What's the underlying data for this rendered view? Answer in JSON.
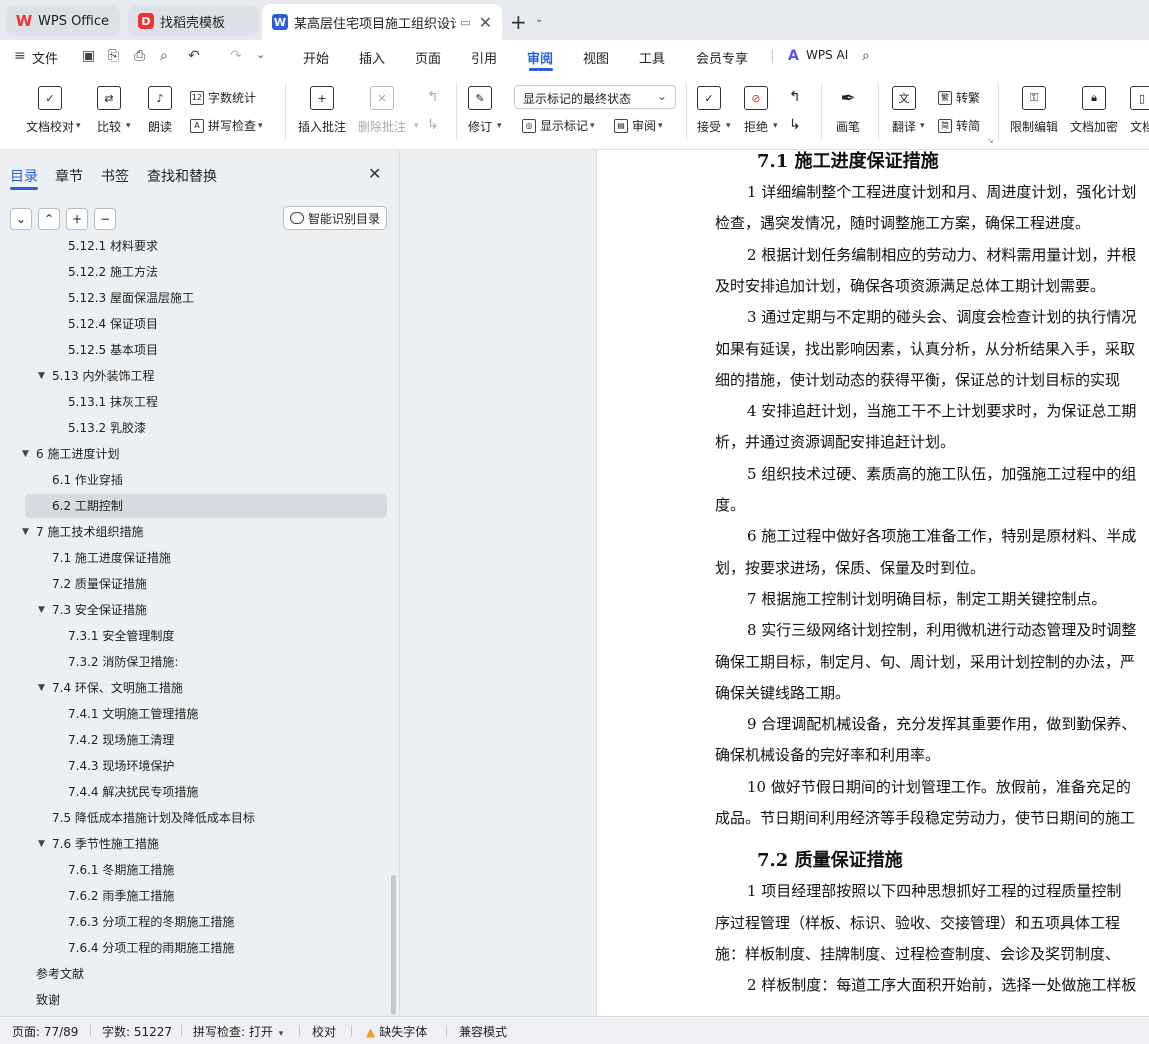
{
  "tabs": [
    {
      "label": "WPS Office",
      "icon": "wps-logo-icon"
    },
    {
      "label": "找稻壳模板",
      "icon": "docer-logo-icon"
    },
    {
      "label": "某高层住宅项目施工组织设计.docx",
      "icon": "word-doc-icon"
    }
  ],
  "menubar": {
    "file": "文件",
    "items": [
      "开始",
      "插入",
      "页面",
      "引用",
      "审阅",
      "视图",
      "工具",
      "会员专享"
    ],
    "active": "审阅",
    "wps_ai": "WPS AI"
  },
  "ribbon": {
    "doc_check": "文档校对",
    "compare": "比较",
    "read_aloud": "朗读",
    "word_count": "字数统计",
    "spell_check": "拼写检查",
    "insert_comment": "插入批注",
    "delete_comment": "删除批注",
    "revise": "修订",
    "markup_state": "显示标记的最终状态",
    "show_markup": "显示标记",
    "review": "审阅",
    "accept": "接受",
    "reject": "拒绝",
    "pen": "画笔",
    "translate": "翻译",
    "to_traditional": "转繁",
    "to_simplified": "转简",
    "restrict_edit": "限制编辑",
    "doc_encrypt": "文档加密",
    "doc_more": "文档"
  },
  "sidebar": {
    "tabs": [
      "目录",
      "章节",
      "书签",
      "查找和替换"
    ],
    "smart_toc": "智能识别目录",
    "toc": [
      {
        "label": "5.12.1 材料要求",
        "level": 3
      },
      {
        "label": "5.12.2 施工方法",
        "level": 3
      },
      {
        "label": "5.12.3 屋面保温层施工",
        "level": 3
      },
      {
        "label": "5.12.4 保证项目",
        "level": 3
      },
      {
        "label": "5.12.5 基本项目",
        "level": 3
      },
      {
        "label": "5.13 内外装饰工程",
        "level": 2,
        "expanded": true
      },
      {
        "label": "5.13.1 抹灰工程",
        "level": 3
      },
      {
        "label": "5.13.2 乳胶漆",
        "level": 3
      },
      {
        "label": "6 施工进度计划",
        "level": 1,
        "expanded": true
      },
      {
        "label": "6.1 作业穿插",
        "level": 2
      },
      {
        "label": "6.2 工期控制",
        "level": 2,
        "selected": true
      },
      {
        "label": "7 施工技术组织措施",
        "level": 1,
        "expanded": true
      },
      {
        "label": "7.1 施工进度保证措施",
        "level": 2
      },
      {
        "label": "7.2 质量保证措施",
        "level": 2
      },
      {
        "label": "7.3 安全保证措施",
        "level": 2,
        "expanded": true
      },
      {
        "label": "7.3.1 安全管理制度",
        "level": 3
      },
      {
        "label": "7.3.2 消防保卫措施:",
        "level": 3
      },
      {
        "label": "7.4 环保、文明施工措施",
        "level": 2,
        "expanded": true
      },
      {
        "label": "7.4.1 文明施工管理措施",
        "level": 3
      },
      {
        "label": "7.4.2 现场施工清理",
        "level": 3
      },
      {
        "label": "7.4.3 现场环境保护",
        "level": 3
      },
      {
        "label": "7.4.4 解决扰民专项措施",
        "level": 3
      },
      {
        "label": "7.5 降低成本措施计划及降低成本目标",
        "level": 2
      },
      {
        "label": "7.6 季节性施工措施",
        "level": 2,
        "expanded": true
      },
      {
        "label": "7.6.1 冬期施工措施",
        "level": 3
      },
      {
        "label": "7.6.2 雨季施工措施",
        "level": 3
      },
      {
        "label": "7.6.3 分项工程的冬期施工措施",
        "level": 3
      },
      {
        "label": "7.6.4 分项工程的雨期施工措施",
        "level": 3
      },
      {
        "label": "参考文献",
        "level": 1
      },
      {
        "label": "致谢",
        "level": 1
      }
    ]
  },
  "document": {
    "lines": [
      {
        "text": "7.1 施工进度保证措施",
        "type": "heading"
      },
      {
        "text": "1 详细编制整个工程进度计划和月、周进度计划，强化计划",
        "type": "indent"
      },
      {
        "text": "检查，遇突发情况，随时调整施工方案，确保工程进度。",
        "type": "body"
      },
      {
        "text": "2 根据计划任务编制相应的劳动力、材料需用量计划，并根",
        "type": "indent"
      },
      {
        "text": "及时安排追加计划，确保各项资源满足总体工期计划需要。",
        "type": "body"
      },
      {
        "text": "3 通过定期与不定期的碰头会、调度会检查计划的执行情况",
        "type": "indent"
      },
      {
        "text": "如果有延误，找出影响因素，认真分析，从分析结果入手，采取",
        "type": "body"
      },
      {
        "text": "细的措施，使计划动态的获得平衡，保证总的计划目标的实现",
        "type": "body"
      },
      {
        "text": "4 安排追赶计划，当施工干不上计划要求时，为保证总工期",
        "type": "indent"
      },
      {
        "text": "析，并通过资源调配安排追赶计划。",
        "type": "body"
      },
      {
        "text": "5 组织技术过硬、素质高的施工队伍，加强施工过程中的组",
        "type": "indent"
      },
      {
        "text": "度。",
        "type": "body"
      },
      {
        "text": "6 施工过程中做好各项施工准备工作，特别是原材料、半成",
        "type": "indent"
      },
      {
        "text": "划，按要求进场，保质、保量及时到位。",
        "type": "body"
      },
      {
        "text": "7 根据施工控制计划明确目标，制定工期关键控制点。",
        "type": "indent"
      },
      {
        "text": "8 实行三级网络计划控制，利用微机进行动态管理及时调整",
        "type": "indent"
      },
      {
        "text": "确保工期目标，制定月、旬、周计划，采用计划控制的办法，严",
        "type": "body"
      },
      {
        "text": "确保关键线路工期。",
        "type": "body"
      },
      {
        "text": "9 合理调配机械设备，充分发挥其重要作用，做到勤保养、",
        "type": "indent"
      },
      {
        "text": "确保机械设备的完好率和利用率。",
        "type": "body"
      },
      {
        "text": "10 做好节假日期间的计划管理工作。放假前，准备充足的",
        "type": "indent"
      },
      {
        "text": "成品。节日期间利用经济等手段稳定劳动力，使节日期间的施工",
        "type": "body"
      },
      {
        "text": "7.2 质量保证措施",
        "type": "heading"
      },
      {
        "text": "1 项目经理部按照以下四种思想抓好工程的过程质量控制",
        "type": "indent"
      },
      {
        "text": "序过程管理（样板、标识、验收、交接管理）和五项具体工程",
        "type": "body"
      },
      {
        "text": "施：样板制度、挂牌制度、过程检查制度、会诊及奖罚制度、",
        "type": "body"
      },
      {
        "text": "2 样板制度：每道工序大面积开始前，选择一处做施工样板",
        "type": "indent"
      }
    ]
  },
  "status": {
    "page": "页面: 77/89",
    "words": "字数: 51227",
    "spell": "拼写检查: 打开",
    "proof": "校对",
    "missing_font": "缺失字体",
    "compat": "兼容模式"
  }
}
